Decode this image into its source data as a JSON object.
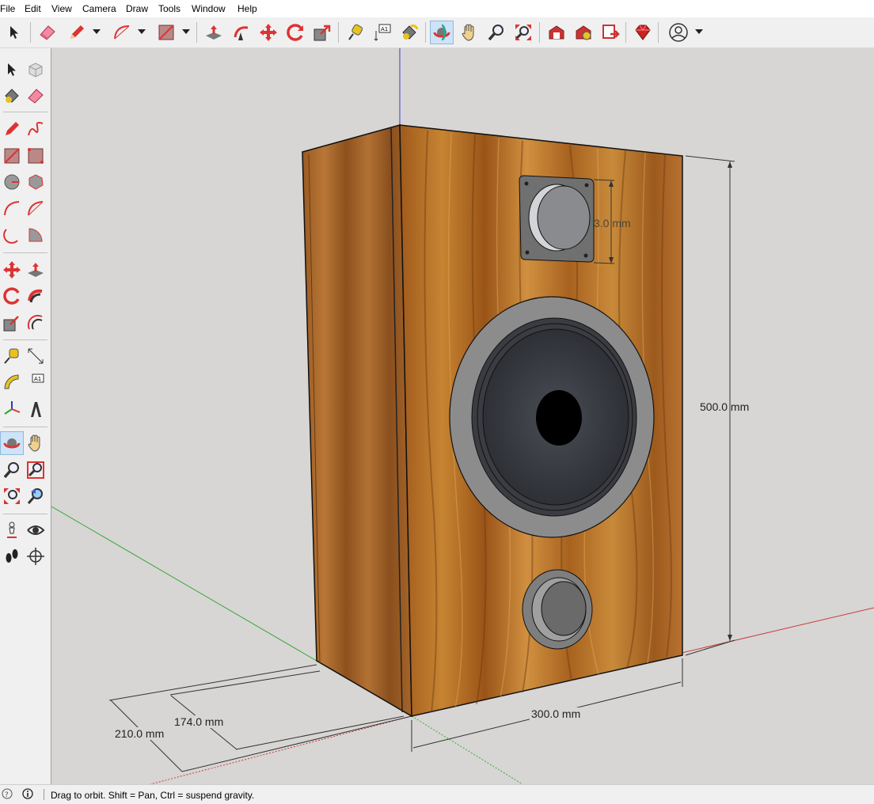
{
  "menu": [
    "File",
    "Edit",
    "View",
    "Camera",
    "Draw",
    "Tools",
    "Window",
    "Help"
  ],
  "toolbar_icons": [
    "select-icon",
    "eraser-icon",
    "pencil-icon",
    "arc-icon",
    "rectangle-icon",
    "push-pull-icon",
    "follow-me-icon",
    "move-icon",
    "rotate-icon",
    "scale-icon",
    "tape-measure-icon",
    "text-icon",
    "paint-bucket-icon",
    "orbit-icon",
    "pan-icon",
    "zoom-icon",
    "zoom-extents-icon",
    "warehouse-icon",
    "extension-warehouse-icon",
    "layout-icon",
    "ruby-icon",
    "account-icon"
  ],
  "dimensions": {
    "height": "500.0 mm",
    "width": "300.0 mm",
    "depth_outer": "210.0 mm",
    "depth_inner": "174.0 mm",
    "tweeter": "3.0 mm"
  },
  "status": {
    "message": "Drag to orbit. Shift = Pan, Ctrl = suspend gravity."
  },
  "colors": {
    "viewport_bg": "#d7d6d4",
    "wood": "#b06a25",
    "axis_red": "#c83c3c",
    "axis_green": "#3aa83a",
    "axis_blue": "#3c3cc8",
    "active_tool": "#cde3f7"
  }
}
